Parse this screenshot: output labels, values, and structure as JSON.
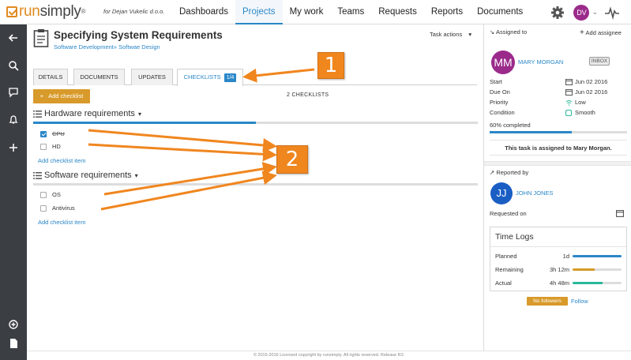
{
  "header": {
    "logo_run": "run",
    "logo_simply": "simply",
    "logo_reg": "®",
    "tenant": "for Dejan Vukelic d.o.o.",
    "nav": [
      "Dashboards",
      "Projects",
      "My work",
      "Teams",
      "Requests",
      "Reports",
      "Documents"
    ],
    "active_nav": "Projects",
    "user_initials": "DV",
    "icons": [
      "gear-icon",
      "chevron-down-icon",
      "pulse-icon"
    ]
  },
  "rail": {
    "icons": [
      "back-arrow-icon",
      "search-icon",
      "chat-icon",
      "bell-icon",
      "plus-icon",
      "add-circle-icon",
      "document-icon"
    ]
  },
  "task": {
    "title": "Specifying System Requirements",
    "breadcrumb": "Software Development» Softwae Design",
    "actions_label": "Task actions"
  },
  "tabs": [
    {
      "label": "DETAILS"
    },
    {
      "label": "DOCUMENTS"
    },
    {
      "label": "UPDATES"
    },
    {
      "label": "CHECKLISTS",
      "badge": "1/4"
    }
  ],
  "toolbar": {
    "add_checklist_label": "Add checklist",
    "checklist_count": "2 CHECKLISTS"
  },
  "checklists": [
    {
      "title": "Hardware requirements",
      "progress": 0.5,
      "items": [
        {
          "label": "CPU",
          "checked": true
        },
        {
          "label": "HD",
          "checked": false
        }
      ],
      "add_item_label": "Add checklist item"
    },
    {
      "title": "Software requirements",
      "progress": 0,
      "items": [
        {
          "label": "OS",
          "checked": false
        },
        {
          "label": "Antivirus",
          "checked": false
        }
      ],
      "add_item_label": "Add checklist item"
    }
  ],
  "sidebar": {
    "assigned_to_label": "Assigned to",
    "add_assignee_label": "Add assignee",
    "assignee_initials": "MM",
    "assignee_name": "MARY MORGAN",
    "inbox_badge": "INBOX",
    "fields": [
      {
        "label": "Start",
        "value": "Jun 02 2016",
        "icon": "calendar-icon"
      },
      {
        "label": "Due On",
        "value": "Jun 02 2016",
        "icon": "calendar-icon"
      },
      {
        "label": "Priority",
        "value": "Low",
        "icon": "wifi-icon"
      },
      {
        "label": "Condition",
        "value": "Smooth",
        "icon": "square-icon"
      }
    ],
    "completed_label": "60% completed",
    "completed": 0.6,
    "assigned_message": "This task is assigned to Mary Morgan.",
    "reported_by_label": "Reported by",
    "reporter_initials": "JJ",
    "reporter_name": "JOHN JONES",
    "requested_on_label": "Requested on",
    "time_logs": {
      "title": "Time Logs",
      "rows": [
        {
          "label": "Planned",
          "value": "1d",
          "fill": 1.0,
          "color": "#2a87c8"
        },
        {
          "label": "Remaining",
          "value": "3h 12m",
          "fill": 0.45,
          "color": "#d89a2a"
        },
        {
          "label": "Actual",
          "value": "4h 48m",
          "fill": 0.62,
          "color": "#2bb89b"
        }
      ]
    },
    "no_followers_label": "No followers",
    "follow_label": "Follow"
  },
  "callouts": [
    "1",
    "2"
  ],
  "footer": "© 2015-2016 Licensed copyright by runsimply. All rights reserved. Release R3."
}
